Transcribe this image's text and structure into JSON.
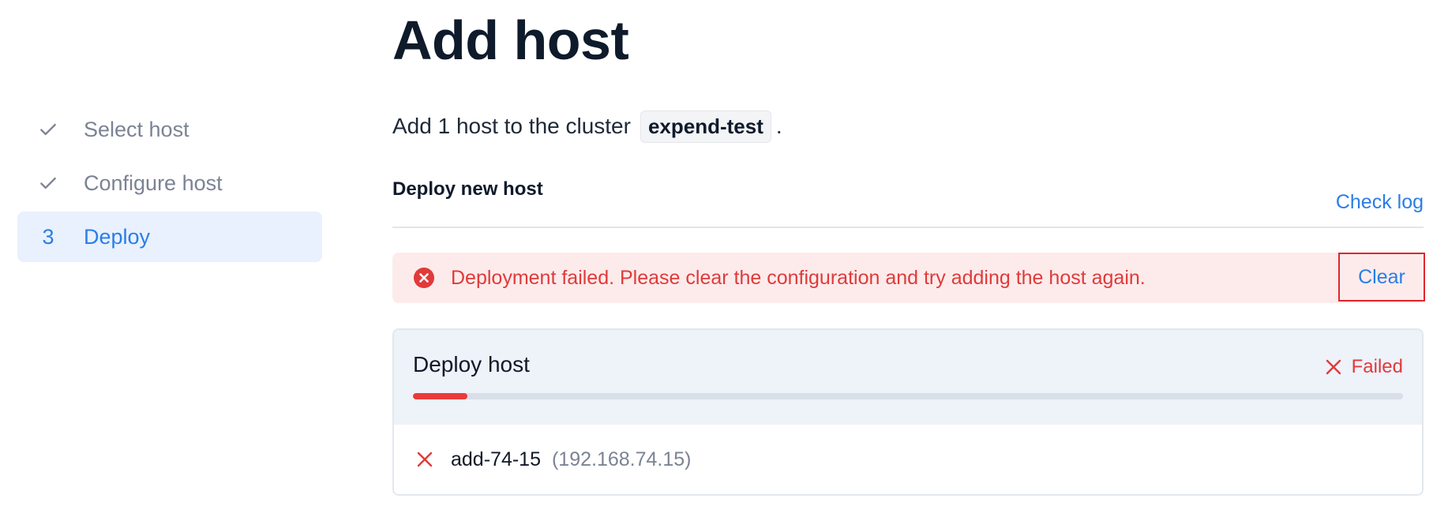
{
  "stepper": {
    "steps": [
      {
        "marker": "check-icon",
        "label": "Select host",
        "state": "done"
      },
      {
        "marker": "check-icon",
        "label": "Configure host",
        "state": "done"
      },
      {
        "marker": "3",
        "label": "Deploy",
        "state": "active"
      }
    ]
  },
  "main": {
    "title": "Add host",
    "intro_prefix": "Add 1 host to the cluster",
    "cluster_name": "expend-test",
    "intro_suffix": ".",
    "section_title": "Deploy new host",
    "check_log_label": "Check log"
  },
  "alert": {
    "icon": "error-circle-icon",
    "message": "Deployment failed. Please clear the configuration and try adding the host again.",
    "clear_label": "Clear"
  },
  "deploy_card": {
    "title": "Deploy host",
    "status_icon": "close-icon",
    "status_label": "Failed",
    "progress_fraction": 0.055,
    "hosts": [
      {
        "icon": "close-icon",
        "name": "add-74-15",
        "ip": "(192.168.74.15)"
      }
    ]
  },
  "colors": {
    "accent": "#2b7de6",
    "error": "#e03a3a",
    "active_step_bg": "#e8f1fd",
    "alert_bg": "#fdebeb",
    "card_head_bg": "#eef2f9"
  }
}
